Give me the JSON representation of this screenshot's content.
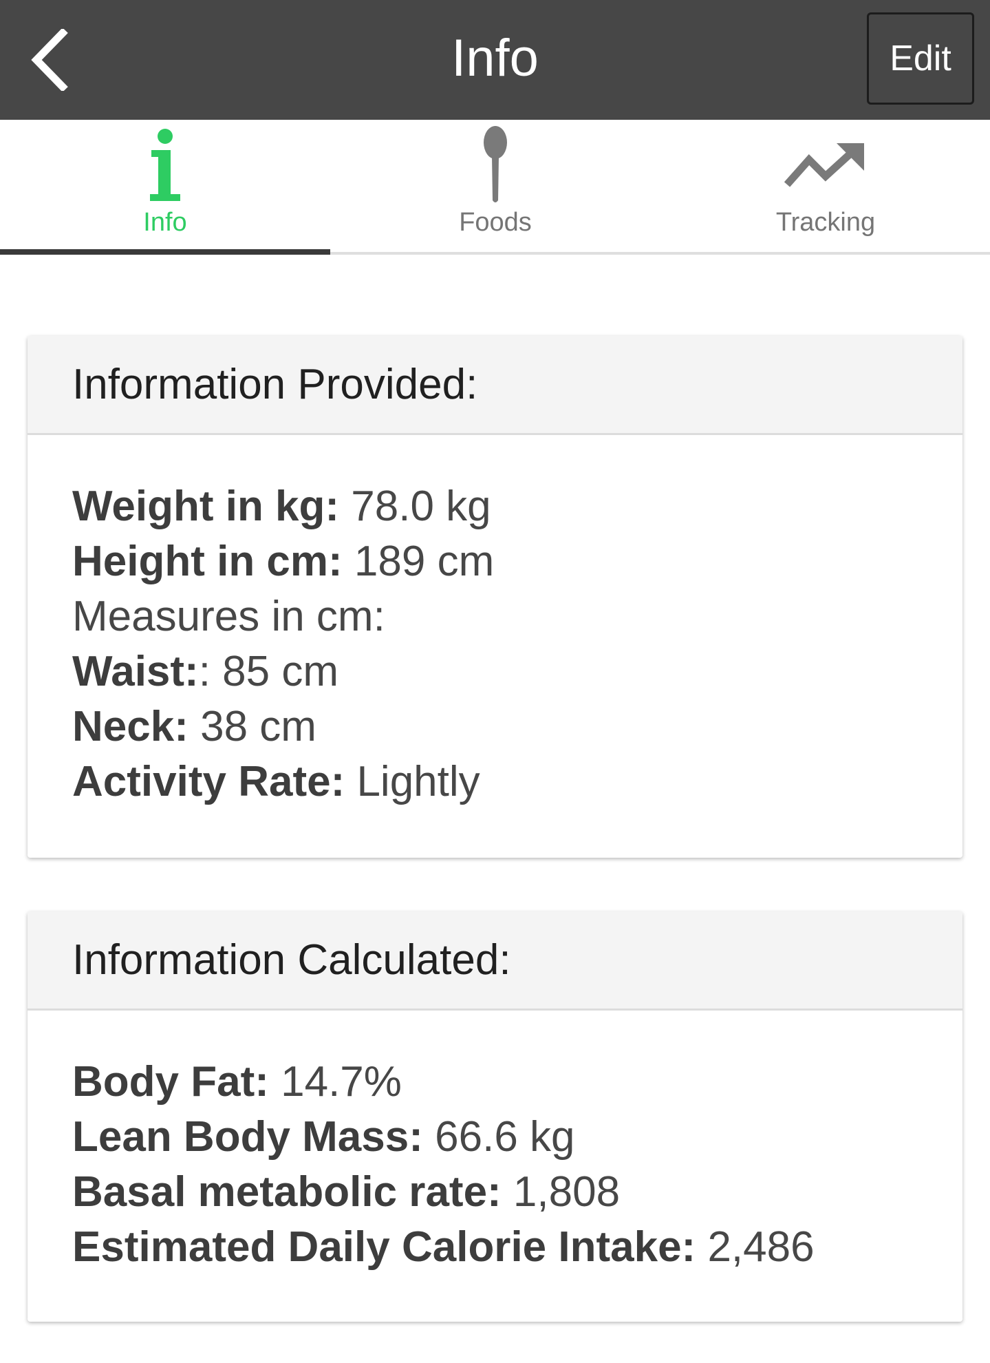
{
  "header": {
    "title": "Info",
    "back_icon": "chevron-left-icon",
    "edit_label": "Edit",
    "background": "#474747"
  },
  "tabs": [
    {
      "label": "Info",
      "icon": "info-icon",
      "active": true
    },
    {
      "label": "Foods",
      "icon": "spoon-icon",
      "active": false
    },
    {
      "label": "Tracking",
      "icon": "trending-up-icon",
      "active": false
    }
  ],
  "colors": {
    "accent": "#2ecc62",
    "inactive_icon": "#7a7a7a"
  },
  "provided": {
    "title": "Information Provided:",
    "weight": {
      "label": "Weight in kg:",
      "value": " 78.0 kg"
    },
    "height": {
      "label": "Height in cm:",
      "value": " 189 cm"
    },
    "measures_heading": "Measures in cm:",
    "waist": {
      "label": "Waist:",
      "value": ": 85 cm"
    },
    "neck": {
      "label": "Neck:",
      "value": " 38 cm"
    },
    "activity": {
      "label": "Activity Rate:",
      "value": " Lightly"
    }
  },
  "calculated": {
    "title": "Information Calculated:",
    "body_fat": {
      "label": "Body Fat:",
      "value": " 14.7%"
    },
    "lean_mass": {
      "label": "Lean Body Mass:",
      "value": " 66.6 kg"
    },
    "bmr": {
      "label": "Basal metabolic rate:",
      "value": " 1,808"
    },
    "calorie_intake": {
      "label": "Estimated Daily Calorie Intake:",
      "value": " 2,486"
    }
  }
}
